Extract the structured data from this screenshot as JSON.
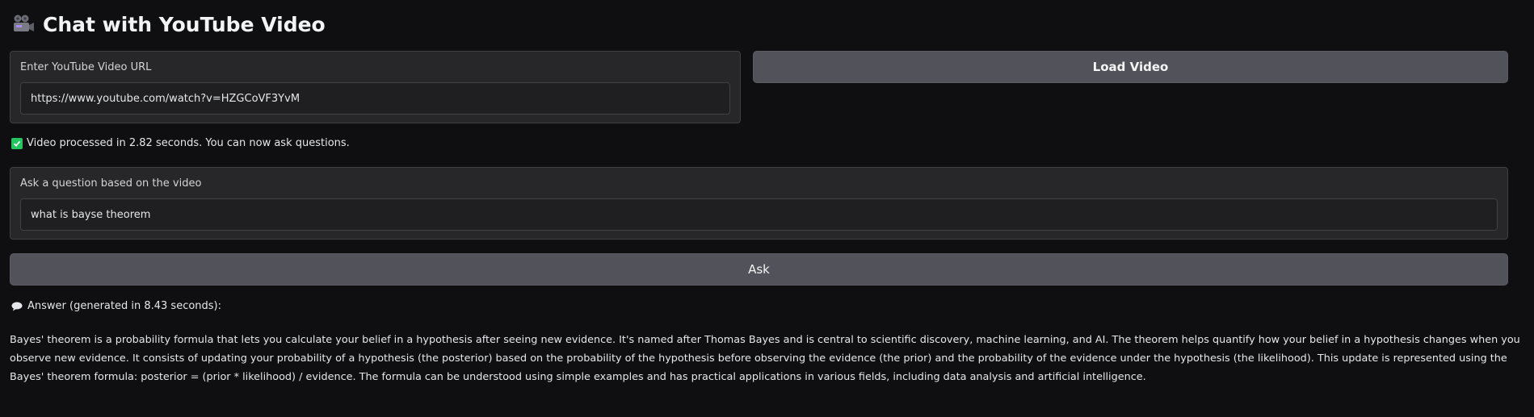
{
  "app": {
    "title": "Chat with YouTube Video",
    "title_icon": "movie-camera-icon"
  },
  "url_panel": {
    "label": "Enter YouTube Video URL",
    "value": "https://www.youtube.com/watch?v=HZGCoVF3YvM"
  },
  "load_button": {
    "label": "Load Video"
  },
  "status": {
    "icon": "check-mark-icon",
    "text": "Video processed in 2.82 seconds. You can now ask questions."
  },
  "question_panel": {
    "label": "Ask a question based on the video",
    "value": "what is bayse theorem"
  },
  "ask_button": {
    "label": "Ask"
  },
  "answer": {
    "icon": "speech-bubble-icon",
    "header": "Answer (generated in 8.43 seconds):",
    "text": "Bayes' theorem is a probability formula that lets you calculate your belief in a hypothesis after seeing new evidence. It's named after Thomas Bayes and is central to scientific discovery, machine learning, and AI. The theorem helps quantify how your belief in a hypothesis changes when you observe new evidence. It consists of updating your probability of a hypothesis (the posterior) based on the probability of the hypothesis before observing the evidence (the prior) and the probability of the evidence under the hypothesis (the likelihood). This update is represented using the Bayes' theorem formula: posterior = (prior * likelihood) / evidence. The formula can be understood using simple examples and has practical applications in various fields, including data analysis and artificial intelligence."
  },
  "colors": {
    "background": "#0f0f11",
    "panel": "#27272a",
    "button": "#52525b",
    "success": "#22c55e"
  }
}
